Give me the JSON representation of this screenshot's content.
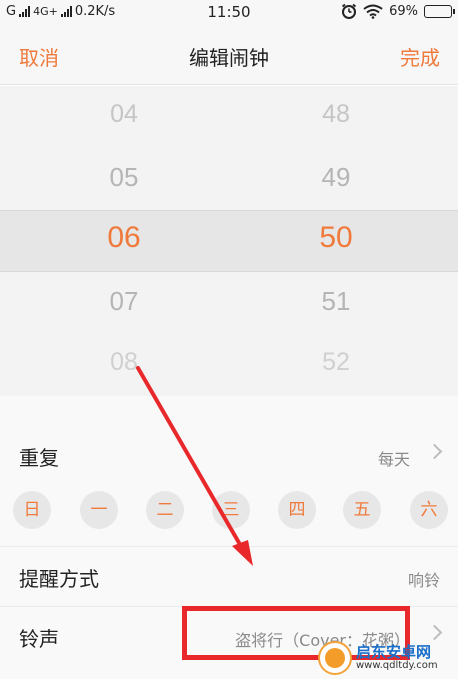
{
  "status_bar": {
    "carrier_1": "G",
    "network": "4G+",
    "speed": "0.2K/s",
    "time": "11:50",
    "battery": "69%",
    "battery_level": 0.69,
    "icons": [
      "signal-icon",
      "alarm-icon",
      "wifi-icon",
      "battery-icon"
    ]
  },
  "nav": {
    "cancel": "取消",
    "title": "编辑闹钟",
    "done": "完成"
  },
  "picker": {
    "hours": [
      "04",
      "05",
      "06",
      "07",
      "08"
    ],
    "minutes": [
      "48",
      "49",
      "50",
      "51",
      "52"
    ],
    "selected_hour": "06",
    "selected_minute": "50"
  },
  "settings": {
    "repeat": {
      "label": "重复",
      "value": "每天"
    },
    "weekdays": [
      "日",
      "一",
      "二",
      "三",
      "四",
      "五",
      "六"
    ],
    "remind": {
      "label": "提醒方式",
      "value": "响铃"
    },
    "ringtone": {
      "label": "铃声",
      "value": "盗将行（Cover：花粥）"
    }
  },
  "watermark": {
    "name": "启东安卓网",
    "url": "www.qdltdy.com"
  },
  "colors": {
    "accent": "#ef7a3b",
    "annotation": "#e8282b"
  }
}
